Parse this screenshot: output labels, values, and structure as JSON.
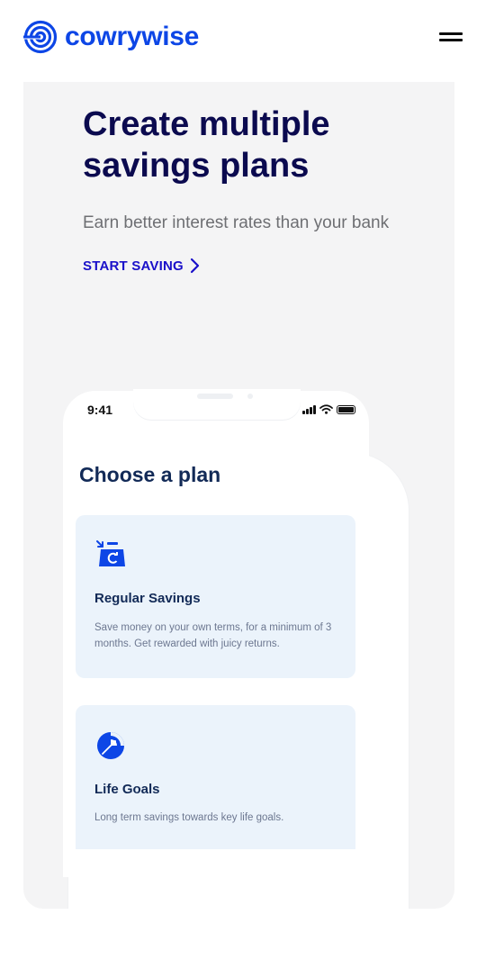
{
  "brand": {
    "name": "cowrywise",
    "color": "#0d46e6",
    "logo_icon": "concentric-rings-logo"
  },
  "header": {
    "menu_icon": "hamburger-menu-icon"
  },
  "hero": {
    "title": "Create multiple savings plans",
    "subtitle": "Earn better interest rates than your bank",
    "cta_label": "START SAVING",
    "cta_icon": "chevron-right-icon"
  },
  "phone": {
    "status_time": "9:41",
    "status_icons": [
      "cellular-signal-icon",
      "wifi-icon",
      "battery-icon"
    ],
    "screen_title": "Choose a plan",
    "plans": [
      {
        "name": "Regular Savings",
        "description": "Save money on your own terms, for a minimum of 3 months. Get rewarded with juicy returns.",
        "icon": "savings-refresh-icon"
      },
      {
        "name": "Life Goals",
        "description": "Long term savings towards key life goals.",
        "icon": "goal-target-icon"
      }
    ]
  },
  "colors": {
    "heading_dark": "#0b0a4f",
    "cta_blue": "#1a10c9",
    "card_bg": "#ebf3fb",
    "hero_bg": "#f4f4f5"
  }
}
